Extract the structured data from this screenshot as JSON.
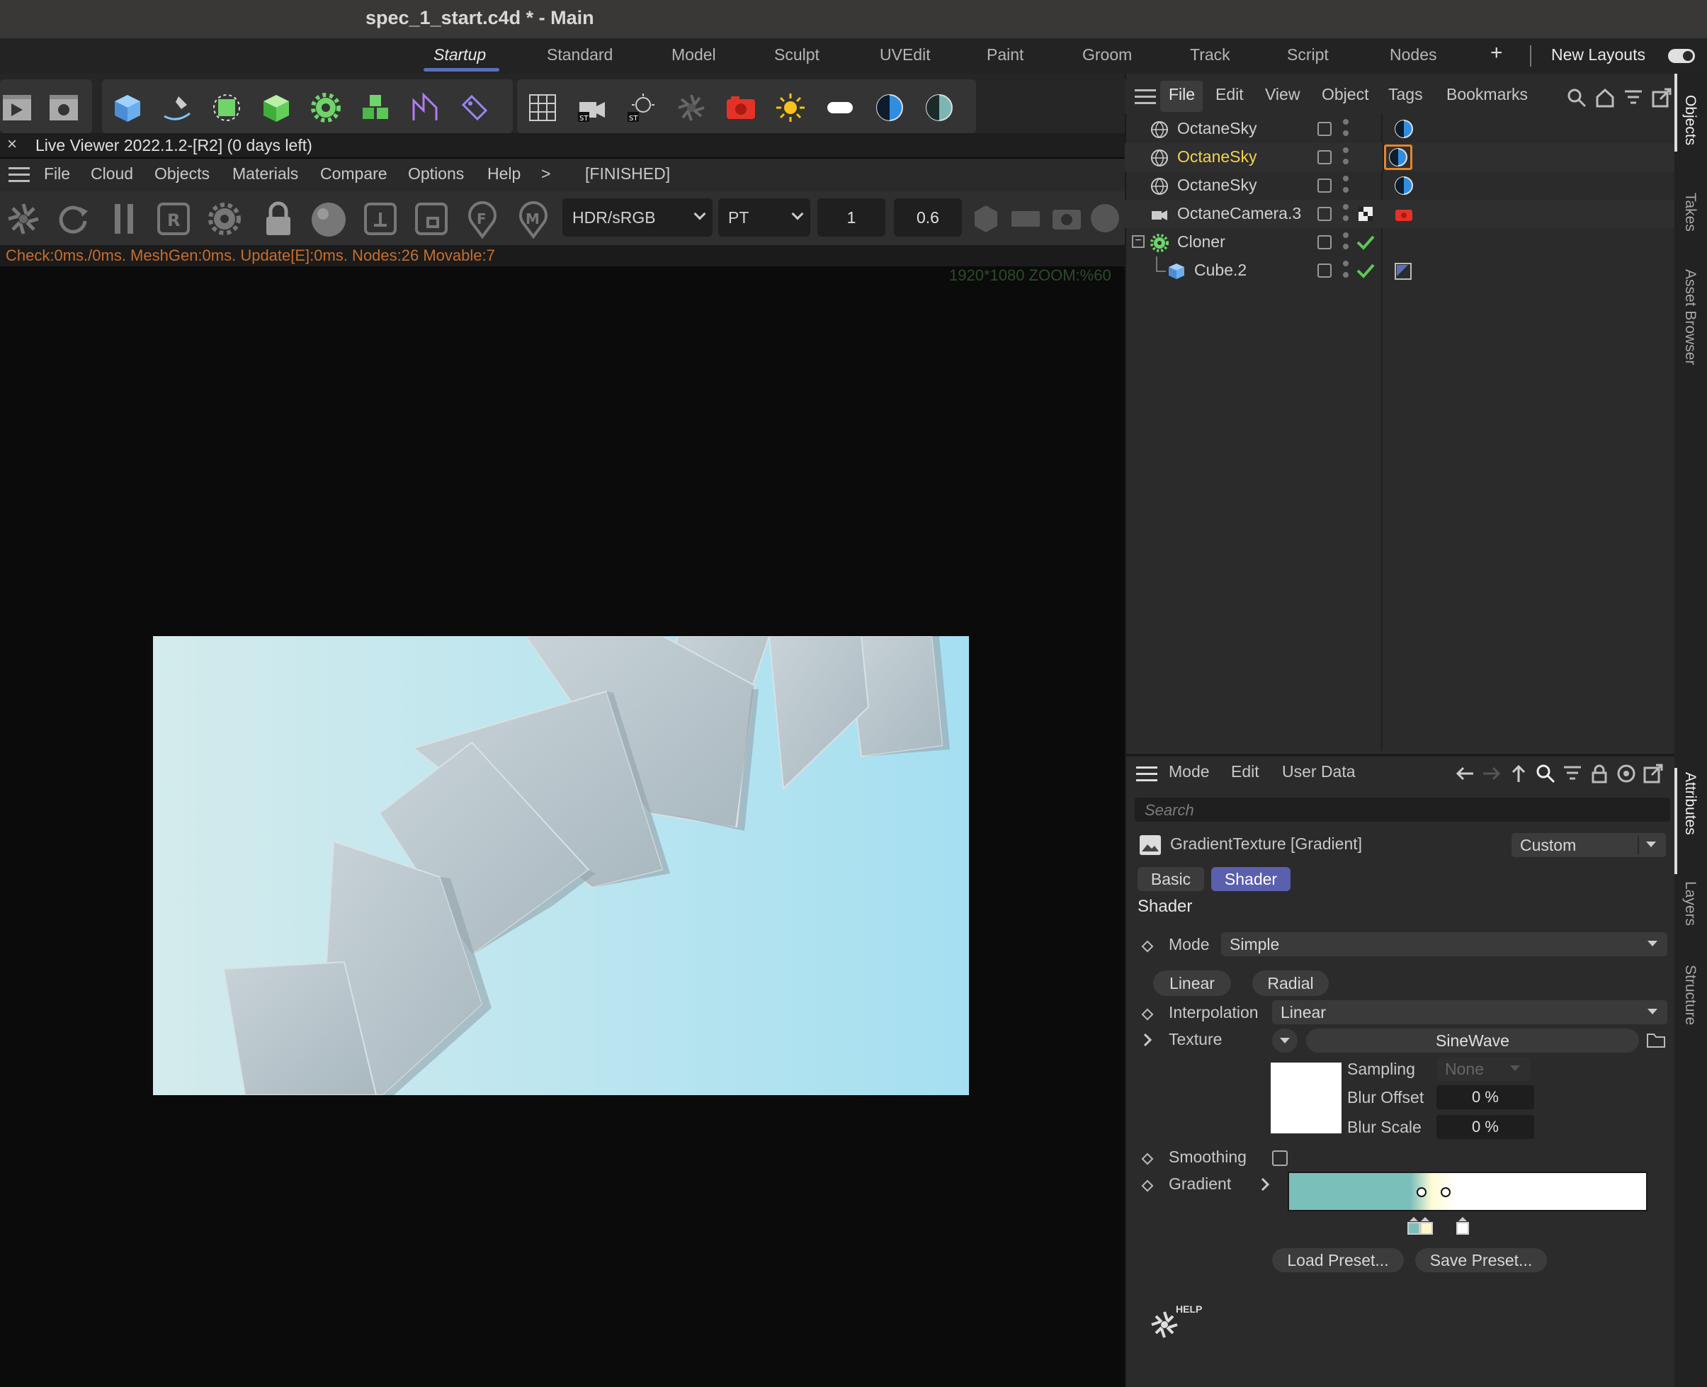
{
  "window": {
    "title": "spec_1_start.c4d * - Main"
  },
  "layouts": {
    "tabs": [
      "Startup",
      "Standard",
      "Model",
      "Sculpt",
      "UVEdit",
      "Paint",
      "Groom",
      "Track",
      "Script",
      "Nodes"
    ],
    "active": "Startup",
    "add_label": "+",
    "new_layouts_label": "New Layouts"
  },
  "toolbar": {
    "icons": [
      "render-view-icon",
      "render-settings-icon",
      "cube-icon",
      "pen-spline-icon",
      "subdivision-icon",
      "extrude-cube-icon",
      "cloner-gear-icon",
      "voxel-icon",
      "deformer-icon",
      "tag-icon",
      "grid-floor-icon",
      "octane-camera-icon",
      "octane-light-icon",
      "octane-logo-icon",
      "octane-render-icon",
      "sun-icon",
      "area-light-icon",
      "octane-sky-icon",
      "hdri-sky-icon"
    ]
  },
  "viewer": {
    "title": "Live Viewer 2022.1.2-[R2] (0 days left)",
    "menu": [
      "File",
      "Cloud",
      "Objects",
      "Materials",
      "Compare",
      "Options",
      "Help"
    ],
    "more": ">",
    "status_tag": "[FINISHED]",
    "colorspace": "HDR/sRGB",
    "kernel": "PT",
    "value1": "1",
    "value2": "0.6",
    "status": "Check:0ms./0ms. MeshGen:0ms. Update[E]:0ms. Nodes:26 Movable:7",
    "resolution": "1920*1080 ZOOM:%60"
  },
  "objects": {
    "menu": [
      "File",
      "Edit",
      "View",
      "Object",
      "Tags",
      "Bookmarks"
    ],
    "rows": [
      {
        "name": "OctaneSky",
        "selected": false,
        "icon": "octane-sky-icon",
        "tag": "sky-tag-icon"
      },
      {
        "name": "OctaneSky",
        "selected": true,
        "icon": "octane-sky-icon",
        "tag": "sky-tag-icon"
      },
      {
        "name": "OctaneSky",
        "selected": false,
        "icon": "octane-sky-icon",
        "tag": "sky-tag-icon"
      },
      {
        "name": "OctaneCamera.3",
        "selected": false,
        "icon": "octane-camera-icon",
        "tag": "camera-tag-icon"
      },
      {
        "name": "Cloner",
        "selected": false,
        "icon": "cloner-icon",
        "tag": ""
      },
      {
        "name": "Cube.2",
        "selected": false,
        "icon": "cube-icon",
        "tag": "material-tag-icon"
      }
    ]
  },
  "sidetabs": {
    "top": [
      "Objects",
      "Takes",
      "Asset Browser"
    ],
    "bottom": [
      "Attributes",
      "Layers",
      "Structure"
    ]
  },
  "attributes": {
    "menu": [
      "Mode",
      "Edit",
      "User Data"
    ],
    "search_placeholder": "Search",
    "object_title": "GradientTexture [Gradient]",
    "preset": "Custom",
    "tabs": [
      "Basic",
      "Shader"
    ],
    "active_tab": "Shader",
    "section": "Shader",
    "mode_label": "Mode",
    "mode_value": "Simple",
    "linear_btn": "Linear",
    "radial_btn": "Radial",
    "interp_label": "Interpolation",
    "interp_value": "Linear",
    "texture_label": "Texture",
    "texture_value": "SineWave",
    "sampling_label": "Sampling",
    "sampling_value": "None",
    "blur_offset_label": "Blur Offset",
    "blur_offset_value": "0 %",
    "blur_scale_label": "Blur Scale",
    "blur_scale_value": "0 %",
    "smoothing_label": "Smoothing",
    "gradient_label": "Gradient",
    "load_preset": "Load Preset...",
    "save_preset": "Save Preset...",
    "help_label": "HELP"
  },
  "colors": {
    "accent": "#5a6fb8",
    "selected_text": "#f3d24f",
    "gradient_start": "#7bbfbb",
    "gradient_end": "#ffffff"
  }
}
